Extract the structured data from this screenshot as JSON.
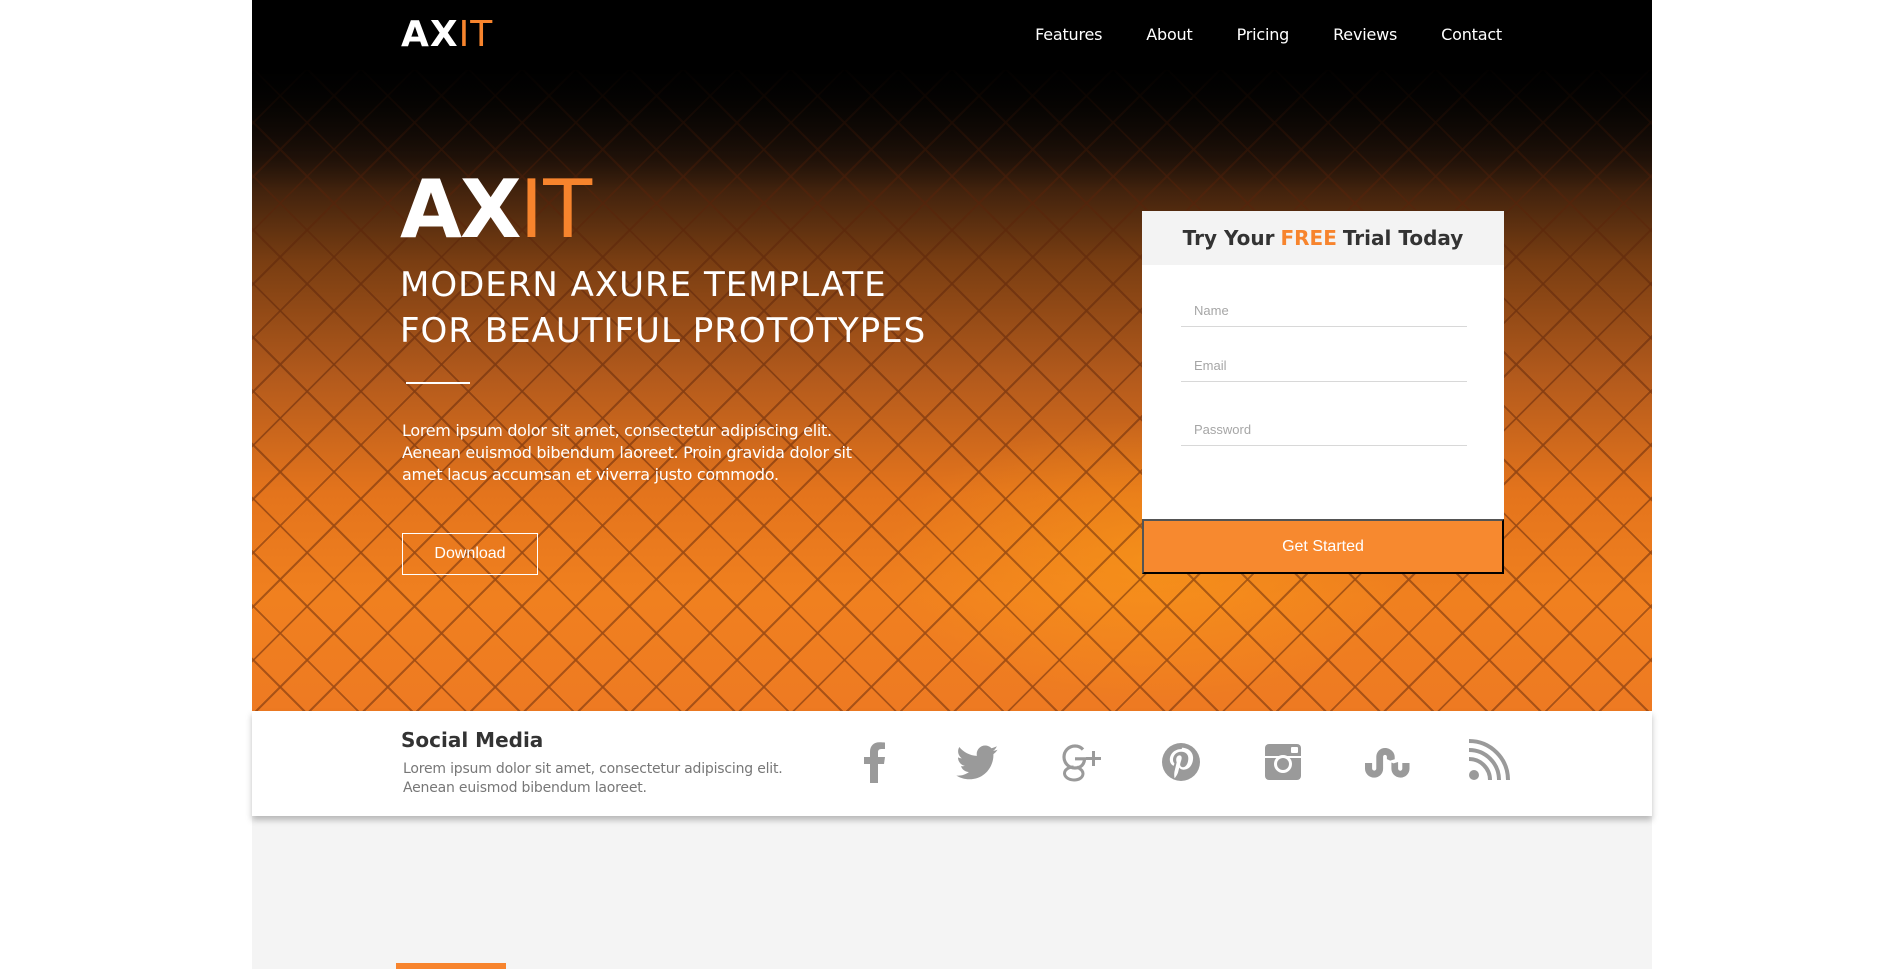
{
  "brand": {
    "name_main": "AX",
    "name_accent": "IT",
    "accent_color": "#f7842d"
  },
  "nav": {
    "items": [
      "Features",
      "About",
      "Pricing",
      "Reviews",
      "Contact"
    ]
  },
  "hero": {
    "logo_main": "AX",
    "logo_accent": "IT",
    "headline_line1": "MODERN AXURE TEMPLATE",
    "headline_line2": "FOR BEAUTIFUL PROTOTYPES",
    "body": "Lorem ipsum dolor sit amet, consectetur adipiscing elit. Aenean euismod bibendum laoreet. Proin gravida dolor sit amet lacus accumsan et viverra justo commodo.",
    "download_label": "Download"
  },
  "trial": {
    "title_pre": "Try Your",
    "title_free": "FREE",
    "title_post": "Trial Today",
    "name_placeholder": "Name",
    "email_placeholder": "Email",
    "password_placeholder": "Password",
    "submit_label": "Get Started"
  },
  "social": {
    "title": "Social Media",
    "description": "Lorem ipsum dolor sit amet, consectetur adipiscing elit. Aenean euismod bibendum laoreet.",
    "icons": [
      "facebook-icon",
      "twitter-icon",
      "google-plus-icon",
      "pinterest-icon",
      "instagram-icon",
      "stumbleupon-icon",
      "rss-icon"
    ],
    "icon_color": "#9a9a9a"
  }
}
